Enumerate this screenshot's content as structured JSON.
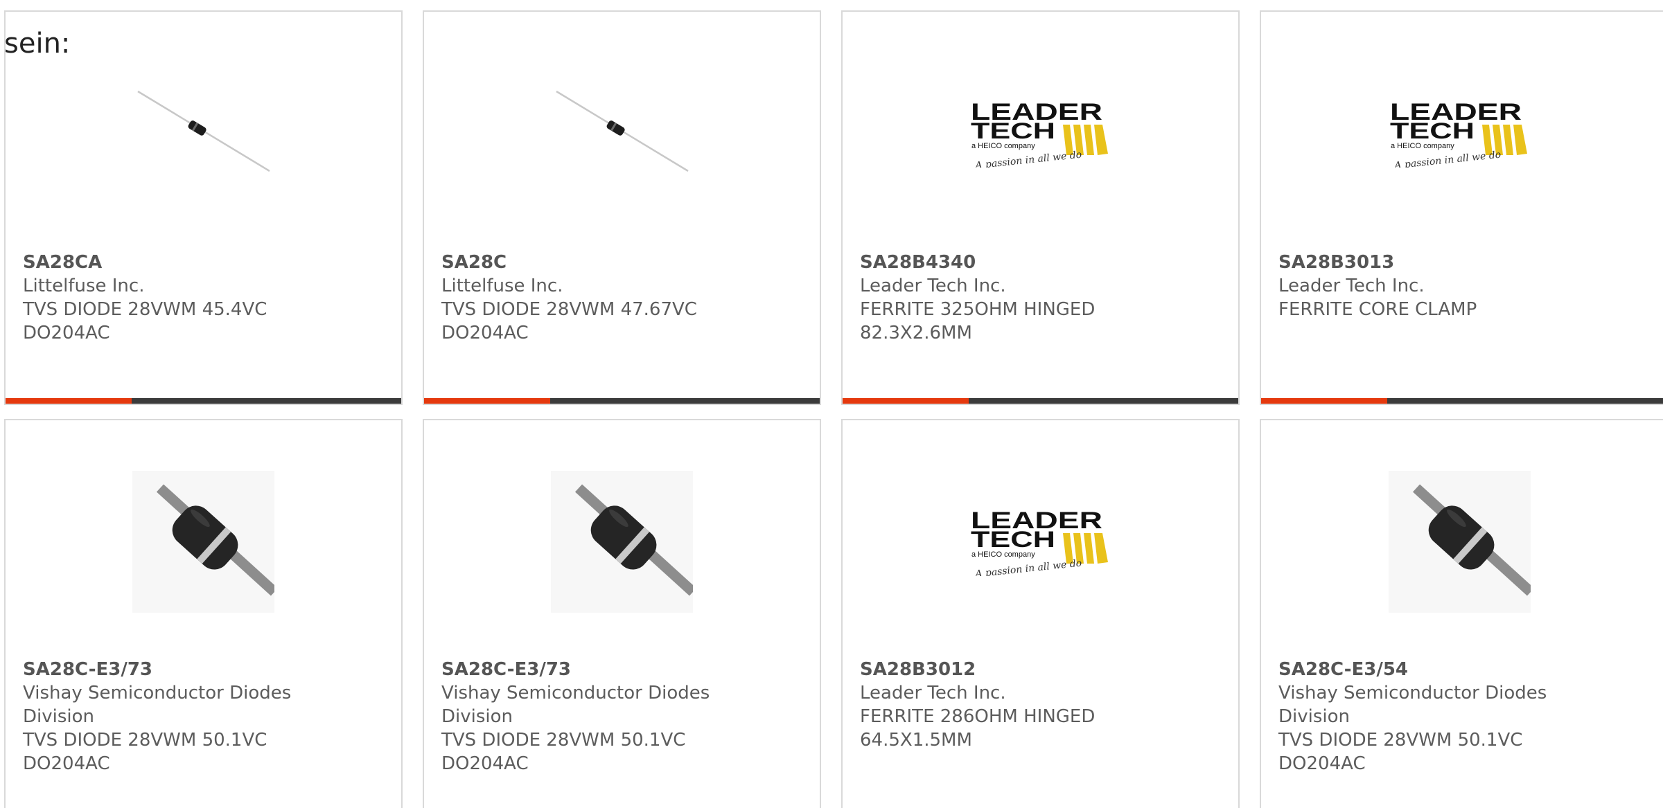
{
  "intro_text": "sein:",
  "colors": {
    "accent": "#e5390e",
    "bar": "#3b3b3b",
    "border": "#d9d9d9",
    "logo_yellow": "#e9c21b"
  },
  "products": [
    {
      "part_number": "SA28CA",
      "manufacturer": "Littelfuse Inc.",
      "description_lines": [
        "TVS DIODE 28VWM 45.4VC",
        "DO204AC"
      ],
      "image": "small-axial-diode"
    },
    {
      "part_number": "SA28C",
      "manufacturer": "Littelfuse Inc.",
      "description_lines": [
        "TVS DIODE 28VWM 47.67VC",
        "DO204AC"
      ],
      "image": "small-axial-diode"
    },
    {
      "part_number": "SA28B4340",
      "manufacturer": "Leader Tech Inc.",
      "description_lines": [
        "FERRITE 325OHM HINGED",
        "82.3X2.6MM"
      ],
      "image": "leader-tech-logo"
    },
    {
      "part_number": "SA28B3013",
      "manufacturer": "Leader Tech Inc.",
      "description_lines": [
        "FERRITE CORE CLAMP"
      ],
      "image": "leader-tech-logo"
    },
    {
      "part_number": "SA28C-E3/73",
      "manufacturer_lines": [
        "Vishay Semiconductor Diodes",
        "Division"
      ],
      "description_lines": [
        "TVS DIODE 28VWM 50.1VC",
        "DO204AC"
      ],
      "image": "large-axial-diode"
    },
    {
      "part_number": "SA28C-E3/73",
      "manufacturer_lines": [
        "Vishay Semiconductor Diodes",
        "Division"
      ],
      "description_lines": [
        "TVS DIODE 28VWM 50.1VC",
        "DO204AC"
      ],
      "image": "large-axial-diode"
    },
    {
      "part_number": "SA28B3012",
      "manufacturer": "Leader Tech Inc.",
      "description_lines": [
        "FERRITE 286OHM HINGED",
        "64.5X1.5MM"
      ],
      "image": "leader-tech-logo"
    },
    {
      "part_number": "SA28C-E3/54",
      "manufacturer_lines": [
        "Vishay Semiconductor Diodes",
        "Division"
      ],
      "description_lines": [
        "TVS DIODE 28VWM 50.1VC",
        "DO204AC"
      ],
      "image": "large-axial-diode"
    }
  ],
  "logo": {
    "line1": "LEADER",
    "line2": "TECH",
    "tagline": "a HEICO company",
    "slogan": "A passion in all we do"
  }
}
